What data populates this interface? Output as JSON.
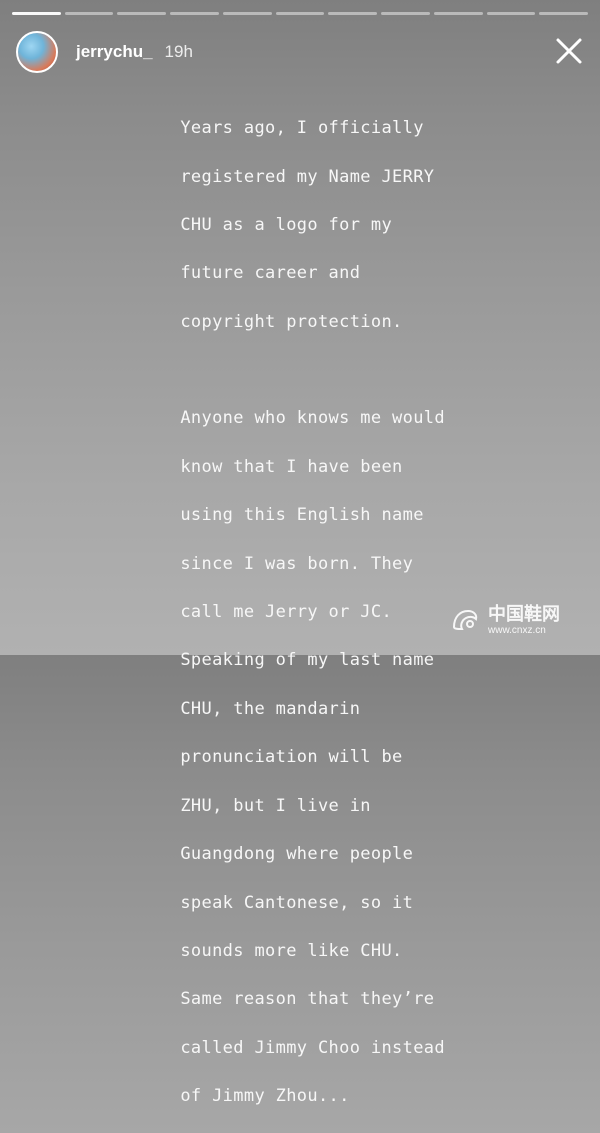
{
  "story": {
    "progress_segments": 11,
    "active_segment": 0
  },
  "header": {
    "username": "jerrychu_",
    "timestamp": "19h",
    "close_icon": "close-icon"
  },
  "content": {
    "paragraph1_lines": [
      "Years ago, I officially",
      "registered my Name JERRY",
      "CHU as a logo for my",
      "future career and",
      "copyright protection."
    ],
    "paragraph2_lines": [
      "Anyone who knows me would",
      "know that I have been",
      "using this English name",
      "since I was born. They",
      "call me Jerry or JC.",
      "Speaking of my last name",
      "CHU, the mandarin",
      "pronunciation will be",
      "ZHU, but I live in",
      "Guangdong where people",
      "speak Cantonese, so it",
      "sounds more like CHU.",
      "Same reason that they’re",
      "called Jimmy Choo instead",
      "of Jimmy Zhou..."
    ]
  },
  "watermark": {
    "text_cn": "中国鞋网",
    "url": "www.cnxz.cn"
  },
  "colors": {
    "text": "#f7f7f7",
    "bg_top": "#7f7f7f",
    "bg_bottom": "#b1b1b1"
  }
}
